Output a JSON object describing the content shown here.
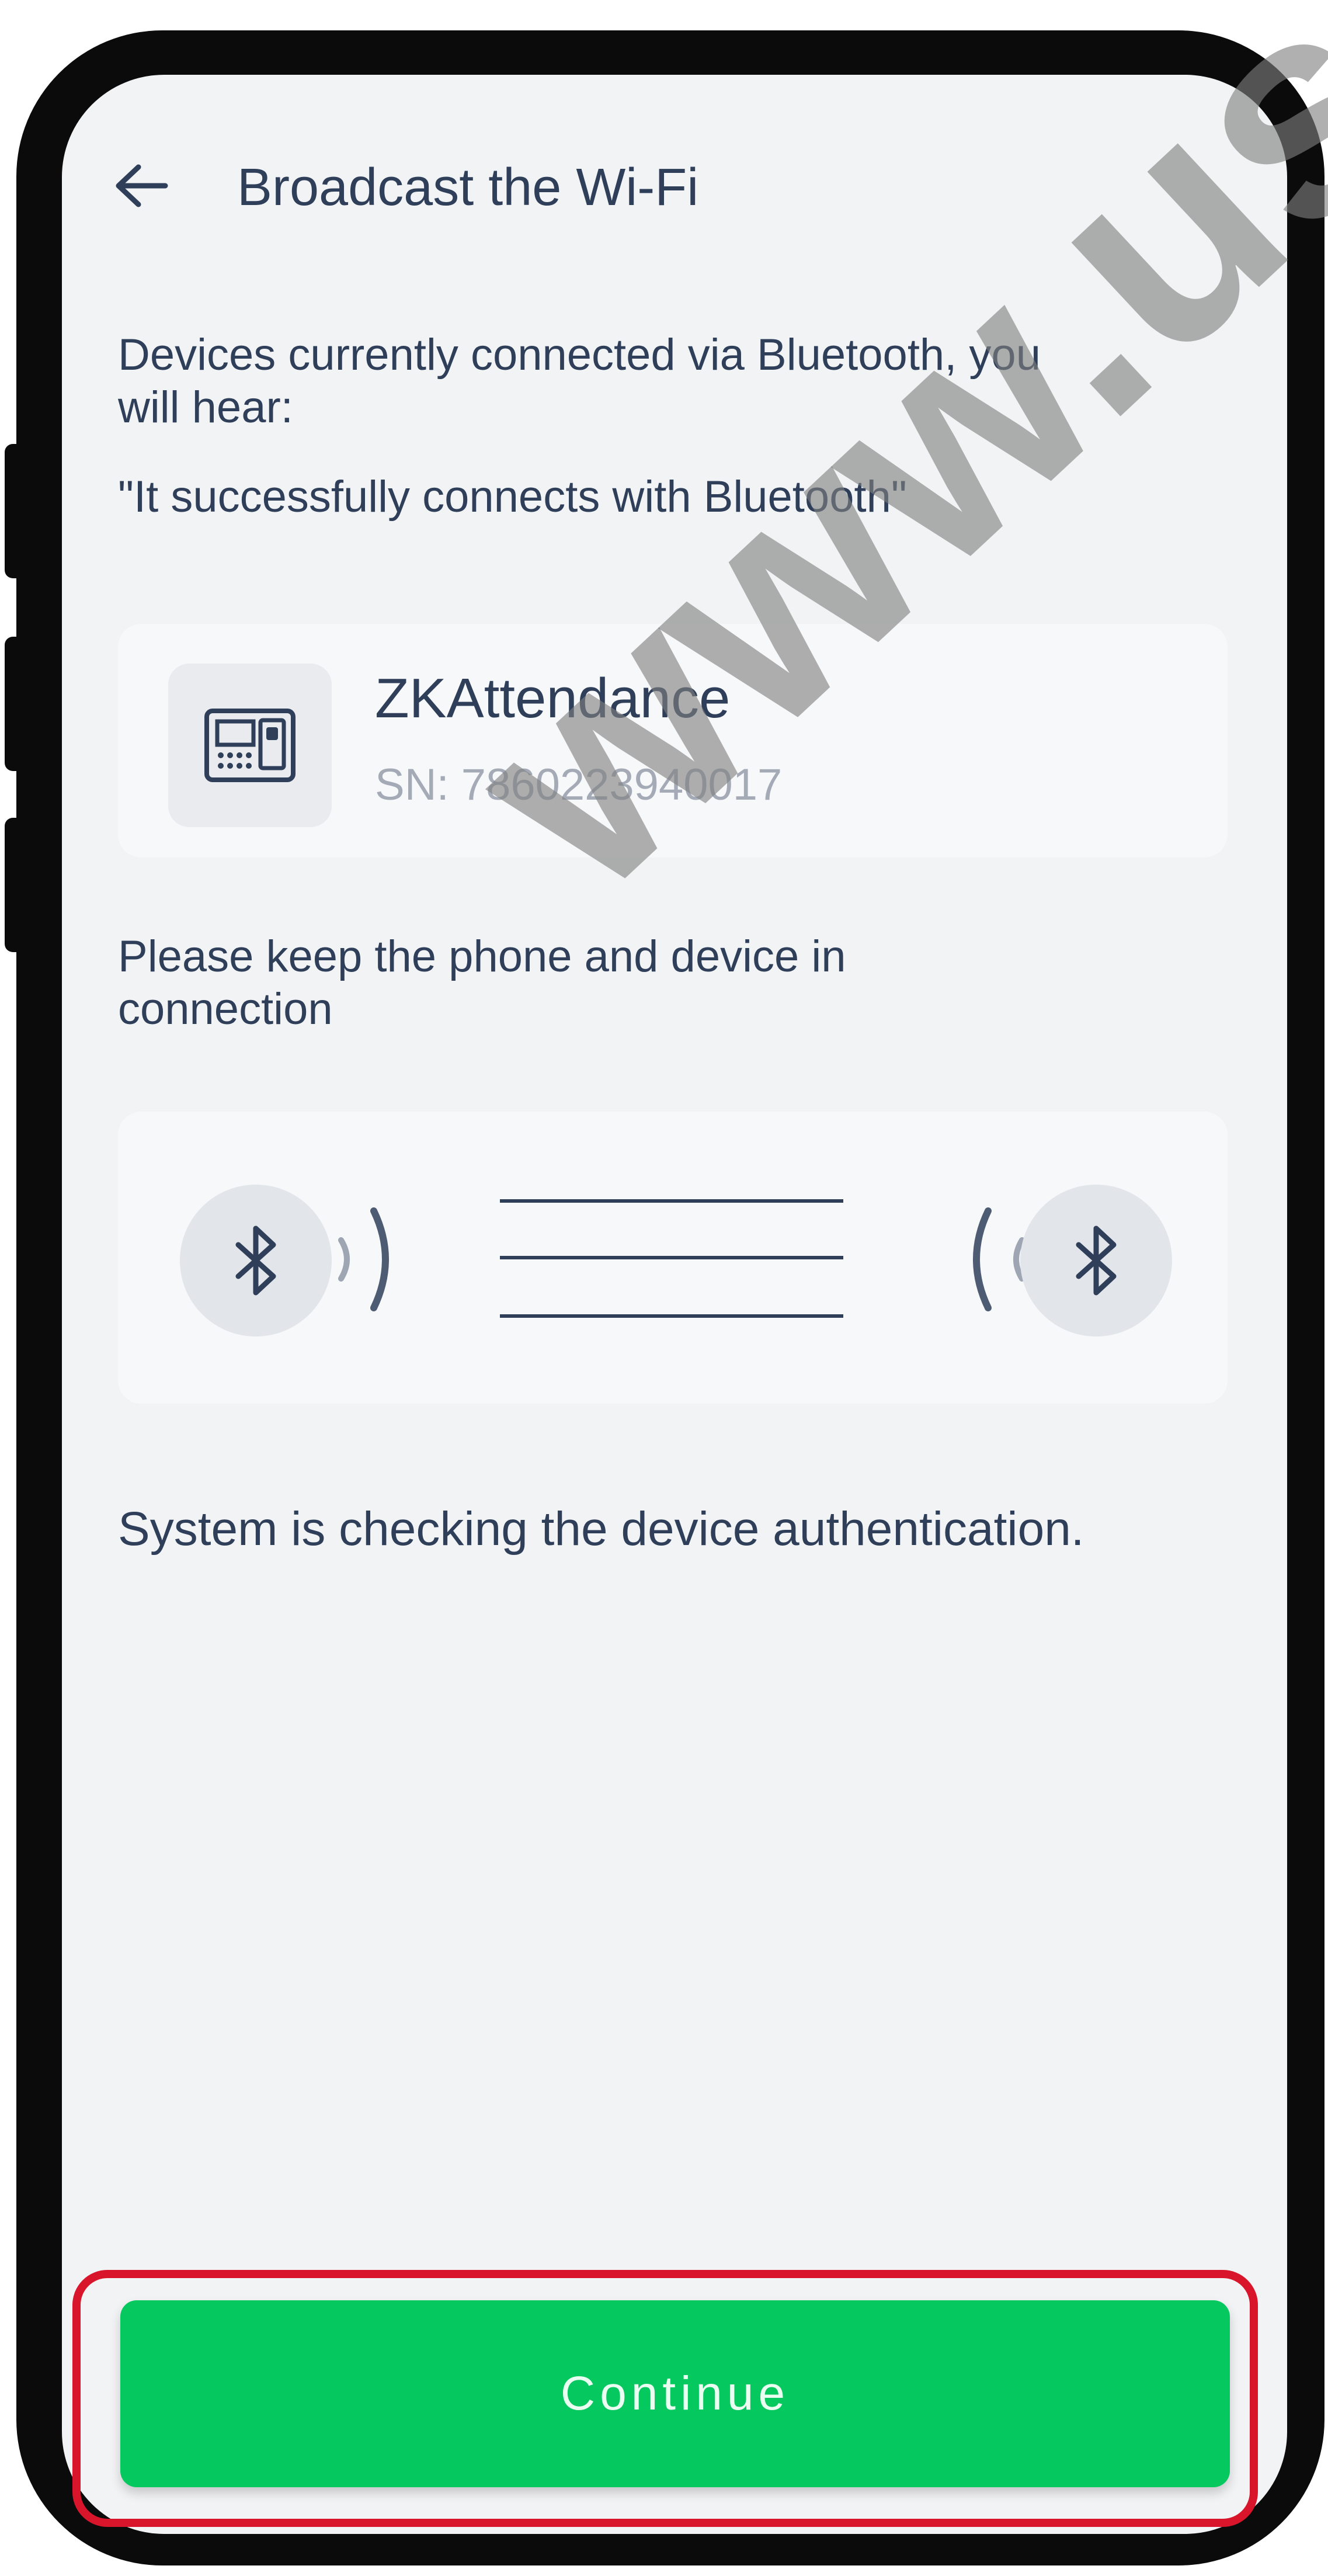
{
  "header": {
    "title": "Broadcast the Wi-Fi"
  },
  "info": {
    "line1": "Devices currently connected via Bluetooth, you",
    "line2": "will hear:",
    "line3": "\"It successfully connects with Bluetooth\""
  },
  "device": {
    "name": "ZKAttendance",
    "sn": "SN: 7860223940017",
    "icon": "attendance-terminal-icon"
  },
  "connection": {
    "line1": "Please keep the phone and device in",
    "line2": "connection",
    "icons": [
      "bluetooth-icon",
      "signal-waves-icon",
      "bluetooth-icon"
    ]
  },
  "status": {
    "text": "System is checking the device authentication."
  },
  "actions": {
    "continue_label": "Continue"
  },
  "watermark": {
    "text": "www.us-"
  },
  "colors": {
    "text": "#2f3f59",
    "muted": "#a4aab6",
    "accent": "#05c85f",
    "highlight": "#d8152a",
    "background": "#f2f3f5"
  }
}
